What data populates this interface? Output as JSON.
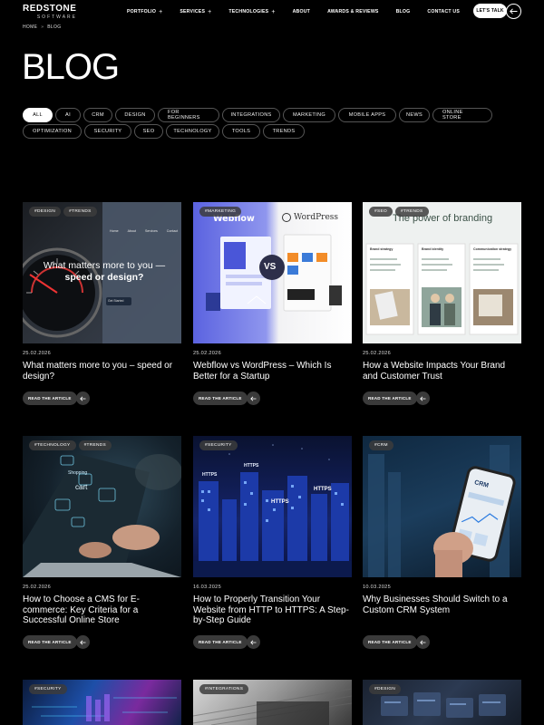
{
  "header": {
    "logo_main": "REDSTONE",
    "logo_sub": "SOFTWARE",
    "nav": [
      {
        "label": "PORTFOLIO",
        "plus": "+"
      },
      {
        "label": "SERVICES",
        "plus": "+"
      },
      {
        "label": "TECHNOLOGIES",
        "plus": "+"
      },
      {
        "label": "ABOUT",
        "plus": ""
      },
      {
        "label": "AWARDS & REVIEWS",
        "plus": ""
      },
      {
        "label": "BLOG",
        "plus": ""
      },
      {
        "label": "CONTACT US",
        "plus": ""
      }
    ],
    "cta_label": "LET'S TALK"
  },
  "breadcrumb": {
    "home": "HOME",
    "separator": "»",
    "current": "BLOG"
  },
  "page_title": "BLOG",
  "filters": [
    "ALL",
    "AI",
    "CRM",
    "DESIGN",
    "FOR BEGINNERS",
    "INTEGRATIONS",
    "MARKETING",
    "MOBILE APPS",
    "NEWS",
    "ONLINE STORE",
    "OPTIMIZATION",
    "SECURITY",
    "SEO",
    "TECHNOLOGY",
    "TOOLS",
    "TRENDS"
  ],
  "active_filter": "ALL",
  "read_label": "READ THE ARTICLE",
  "cards": [
    {
      "tags": [
        "#DESIGN",
        "#TRENDS"
      ],
      "date": "25.02.2026",
      "title": "What matters more to you – speed or design?",
      "img_text": {
        "headline": "What matters more to you —",
        "headline_bold": "speed or design?",
        "nav": [
          "Home",
          "About",
          "Services",
          "Contact"
        ],
        "button": "Get Started"
      }
    },
    {
      "tags": [
        "#MARKETING"
      ],
      "date": "25.02.2026",
      "title": "Webflow vs WordPress – Which Is Better for a Startup",
      "img_text": {
        "left": "Webflow",
        "right": "WordPress",
        "vs": "VS"
      }
    },
    {
      "tags": [
        "#SEO",
        "#TRENDS"
      ],
      "date": "25.02.2026",
      "title": "How a Website Impacts Your Brand and Customer Trust",
      "img_text": {
        "headline": "The power of branding",
        "cols": [
          "Brand strategy",
          "Brand identity",
          "Communication strategy"
        ]
      }
    },
    {
      "tags": [
        "#TECHNOLOGY",
        "#TRENDS"
      ],
      "date": "25.02.2026",
      "title": "How to Choose a CMS for E-commerce: Key Criteria for a Successful Online Store",
      "img_text": {
        "shopping": "Shopping",
        "cart": "cart"
      }
    },
    {
      "tags": [
        "#SECURITY"
      ],
      "date": "16.03.2025",
      "title": "How to Properly Transition Your Website from HTTP to HTTPS: A Step-by-Step Guide",
      "img_text": {
        "labels": [
          "HTTPS",
          "HTTPS",
          "HTTPS",
          "HTTPS"
        ]
      }
    },
    {
      "tags": [
        "#CRM"
      ],
      "date": "10.03.2025",
      "title": "Why Businesses Should Switch to a Custom CRM System",
      "img_text": {
        "phone": "CRM"
      }
    },
    {
      "tags": [
        "#SECURITY"
      ]
    },
    {
      "tags": [
        "#INTEGRATIONS"
      ]
    },
    {
      "tags": [
        "#DESIGN"
      ]
    }
  ],
  "colors": {
    "background": "#000000",
    "accent": "#ffffff",
    "chip_border": "#555555",
    "button_bg": "#3a3a3a"
  }
}
